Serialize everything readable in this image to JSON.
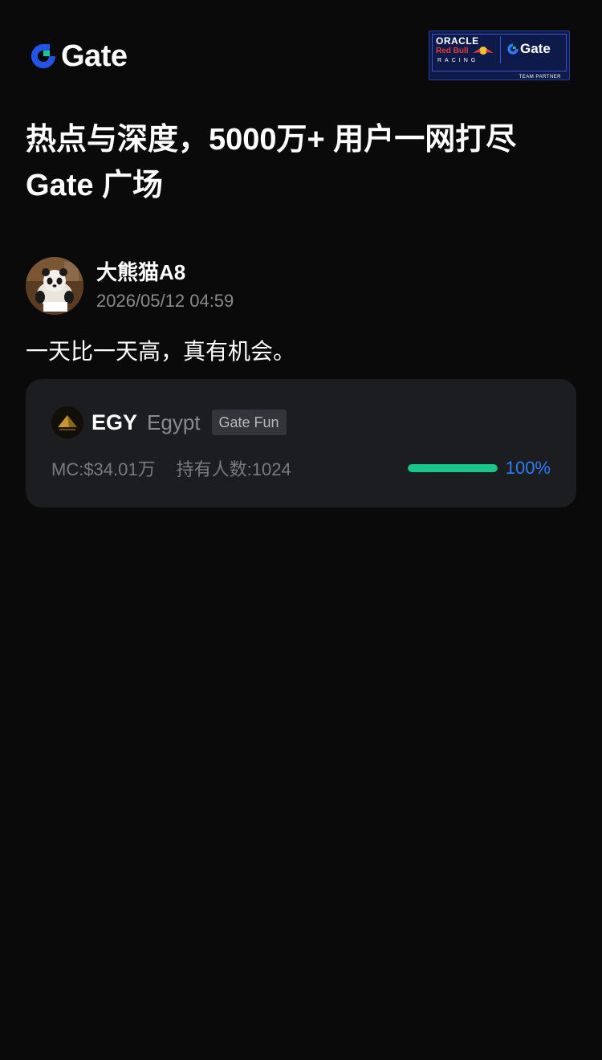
{
  "brand": {
    "logo_text": "Gate",
    "accent_color": "#2354e6",
    "partner_badge": {
      "oracle": "ORACLE",
      "redbull": "Red Bull",
      "racing": "RACING",
      "gate": "Gate",
      "team": "TEAM PARTNER"
    }
  },
  "headline": "热点与深度，5000万+ 用户一网打尽 Gate 广场",
  "post": {
    "author_name": "大熊猫A8",
    "timestamp": "2026/05/12 04:59",
    "text": "一天比一天高，真有机会。"
  },
  "token_card": {
    "symbol": "EGY",
    "name": "Egypt",
    "tag": "Gate Fun",
    "market_cap": "MC:$34.01万",
    "holders": "持有人数:1024",
    "progress_percent": 100,
    "progress_label": "100%",
    "progress_color": "#19c58a",
    "progress_label_color": "#2f7bf6"
  }
}
